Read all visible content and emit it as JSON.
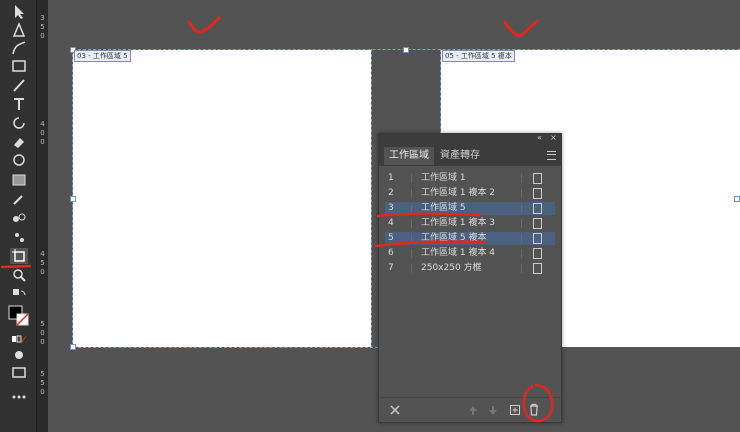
{
  "artboards": {
    "left_label": "03 - 工作區域 5",
    "right_label": "05 - 工作區域 5 複本"
  },
  "ruler": {
    "marks": [
      "3",
      "5",
      "0",
      "4",
      "0",
      "0",
      "4",
      "5",
      "0",
      "5",
      "0",
      "0",
      "5",
      "5",
      "0"
    ]
  },
  "panel": {
    "tabs": [
      "工作區域",
      "資產轉存"
    ],
    "collapse_icon": "double-chevron-icon",
    "close_icon": "close-icon",
    "menu_icon": "hamburger-menu-icon",
    "rows": [
      {
        "num": "1",
        "name": "工作區域 1",
        "selected": false
      },
      {
        "num": "2",
        "name": "工作區域 1 複本 2",
        "selected": false
      },
      {
        "num": "3",
        "name": "工作區域 5",
        "selected": true
      },
      {
        "num": "4",
        "name": "工作區域 1 複本 3",
        "selected": false
      },
      {
        "num": "5",
        "name": "工作區域 5 複本",
        "selected": true
      },
      {
        "num": "6",
        "name": "工作區域 1 複本 4",
        "selected": false
      },
      {
        "num": "7",
        "name": "250x250 方框",
        "selected": false
      }
    ],
    "bottom_icons": [
      "rearrange-icon",
      "move-up-icon",
      "move-down-icon",
      "new-artboard-icon",
      "delete-artboard-icon"
    ]
  },
  "colors": {
    "canvas": "#535353",
    "panel_selection": "#4a6280",
    "annotation_red": "#e0281f"
  }
}
